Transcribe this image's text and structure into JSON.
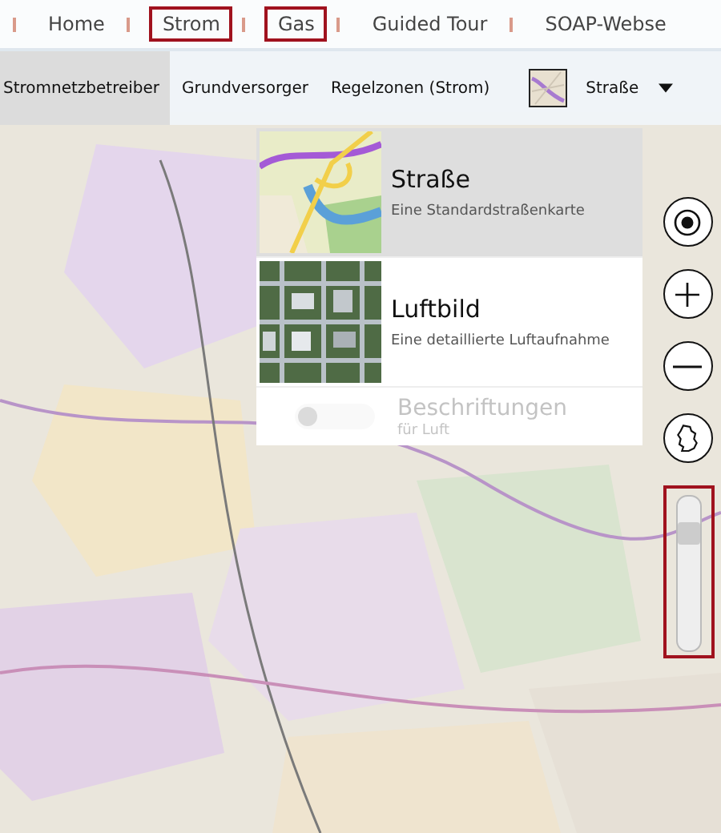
{
  "nav": {
    "items": [
      {
        "label": "Home",
        "highlighted": false
      },
      {
        "label": "Strom",
        "highlighted": true
      },
      {
        "label": "Gas",
        "highlighted": true
      },
      {
        "label": "Guided Tour",
        "highlighted": false
      },
      {
        "label": "SOAP-Webse",
        "highlighted": false
      }
    ]
  },
  "toolbar": {
    "layers": [
      {
        "label": "Stromnetzbetreiber",
        "selected": true
      },
      {
        "label": "Grundversorger",
        "selected": false
      },
      {
        "label": "Regelzonen (Strom)",
        "selected": false
      }
    ],
    "map_style": "Straße"
  },
  "style_menu": {
    "options": [
      {
        "kind": "road",
        "title": "Straße",
        "subtitle": "Eine Standardstraßenkarte",
        "selected": true
      },
      {
        "kind": "aerial",
        "title": "Luftbild",
        "subtitle": "Eine detaillierte Luftaufnahme",
        "selected": false
      }
    ],
    "labels_toggle": {
      "title": "Beschriftungen",
      "subtitle": "für Luft",
      "on": false,
      "disabled": true
    }
  },
  "zoom_slider": {
    "level": 0.8,
    "highlighted": true
  }
}
